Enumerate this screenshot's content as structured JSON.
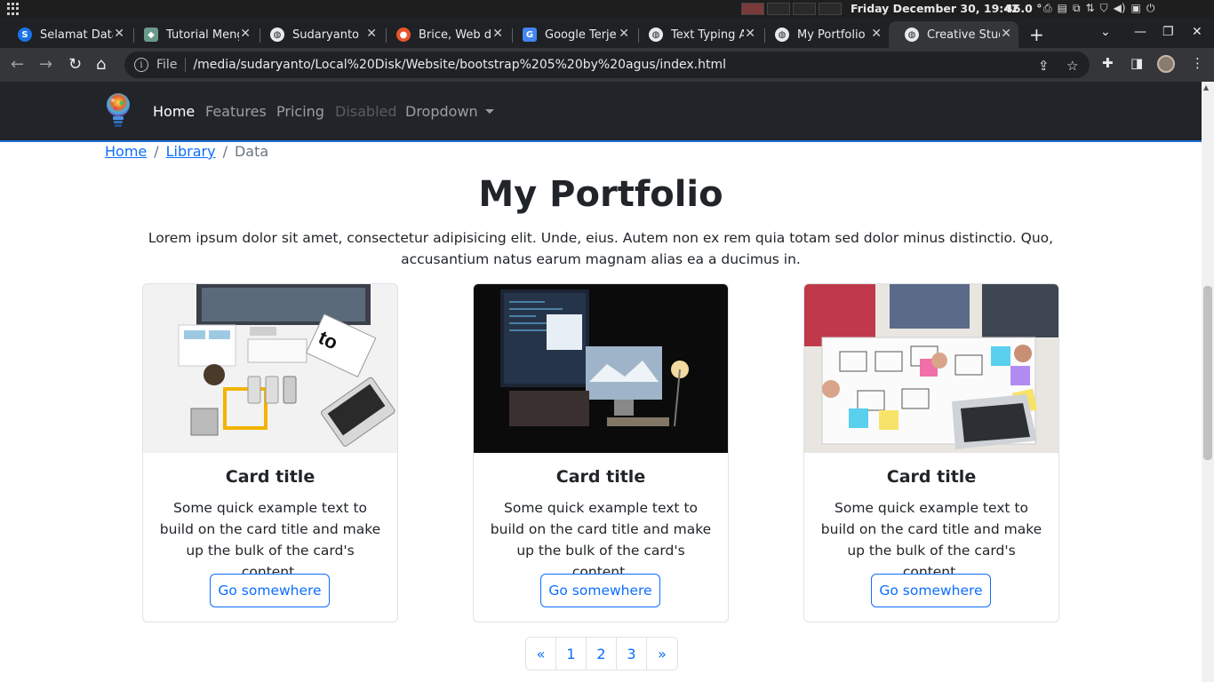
{
  "os": {
    "datetime": "Friday December 30, 19:42",
    "temperature": "46.0 °"
  },
  "tabs": [
    {
      "label": "Selamat Data",
      "icon": "s-circle-icon",
      "color": "#1a73e8"
    },
    {
      "label": "Tutorial Meng",
      "icon": "cube-icon",
      "color": "#e24b6a"
    },
    {
      "label": "Sudaryanto",
      "icon": "globe-icon",
      "color": "#e8eaed"
    },
    {
      "label": "Brice, Web de",
      "icon": "orange-logo-icon",
      "color": "#e8552a"
    },
    {
      "label": "Google Terje",
      "icon": "google-translate-icon",
      "color": "#4285f4"
    },
    {
      "label": "Text Typing A",
      "icon": "globe-icon",
      "color": "#e8eaed"
    },
    {
      "label": "My Portfolio",
      "icon": "globe-icon",
      "color": "#e8eaed"
    },
    {
      "label": "Creative Stud",
      "icon": "globe-icon",
      "color": "#e8eaed"
    }
  ],
  "address": {
    "scheme": "File",
    "url": "/media/sudaryanto/Local%20Disk/Website/bootstrap%205%20by%20agus/index.html"
  },
  "site": {
    "nav": {
      "home": "Home",
      "features": "Features",
      "pricing": "Pricing",
      "disabled": "Disabled",
      "dropdown": "Dropdown"
    },
    "breadcrumb": {
      "home": "Home",
      "library": "Library",
      "current": "Data",
      "separator": "/"
    },
    "title": "My Portfolio",
    "lead": "Lorem ipsum dolor sit amet, consectetur adipisicing elit. Unde, eius. Autem non ex rem quia totam sed dolor minus distinctio. Quo, accusantium natus earum magnam alias ea a ducimus in.",
    "cards": [
      {
        "title": "Card title",
        "text": "Some quick example text to build on the card title and make up the bulk of the card's content.",
        "button": "Go somewhere"
      },
      {
        "title": "Card title",
        "text": "Some quick example text to build on the card title and make up the bulk of the card's content.",
        "button": "Go somewhere"
      },
      {
        "title": "Card title",
        "text": "Some quick example text to build on the card title and make up the bulk of the card's content.",
        "button": "Go somewhere"
      }
    ],
    "pagination": [
      "«",
      "1",
      "2",
      "3",
      "»"
    ]
  },
  "colors": {
    "primary": "#0d6efd",
    "navbar": "#212529",
    "chrome_dark": "#202124"
  }
}
